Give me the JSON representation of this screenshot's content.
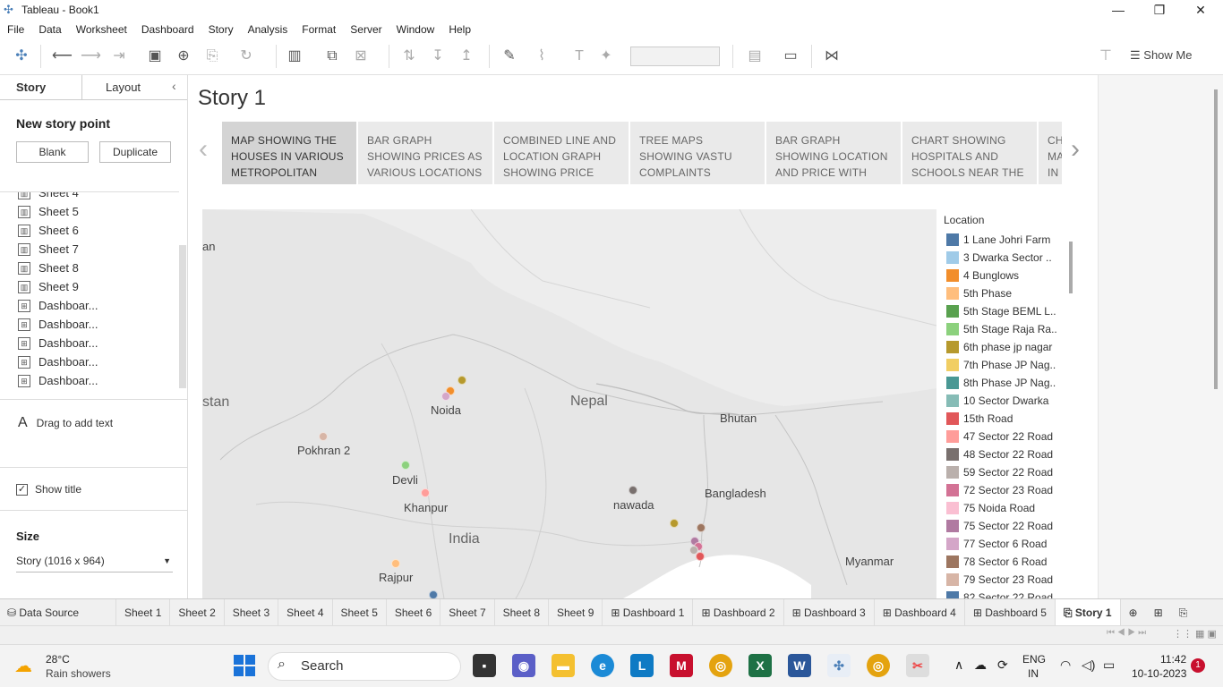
{
  "window": {
    "title": "Tableau - Book1",
    "minimize": "—",
    "restore": "❐",
    "close": "✕"
  },
  "menu": [
    "File",
    "Data",
    "Worksheet",
    "Dashboard",
    "Story",
    "Analysis",
    "Format",
    "Server",
    "Window",
    "Help"
  ],
  "toolbar": {
    "show_me": "Show Me"
  },
  "left_panel": {
    "tabs": {
      "story": "Story",
      "layout": "Layout"
    },
    "new_story_point": "New story point",
    "blank": "Blank",
    "duplicate": "Duplicate",
    "sheets": [
      "Sheet 4",
      "Sheet 5",
      "Sheet 6",
      "Sheet 7",
      "Sheet 8",
      "Sheet 9",
      "Dashboar...",
      "Dashboar...",
      "Dashboar...",
      "Dashboar...",
      "Dashboar..."
    ],
    "drag_text_icon": "A",
    "drag_text": "Drag to add text",
    "show_title": "Show title",
    "size_heading": "Size",
    "size_value": "Story (1016 x 964)"
  },
  "story": {
    "title": "Story 1",
    "points": [
      "MAP SHOWING THE HOUSES IN VARIOUS METROPOLITAN",
      "BAR GRAPH SHOWING PRICES AS VARIOUS LOCATIONS",
      "COMBINED LINE AND LOCATION GRAPH SHOWING PRICE AND",
      "TREE MAPS SHOWING VASTU COMPLAINTS",
      " BAR GRAPH SHOWING LOCATION AND PRICE WITH",
      "CHART SHOWING HOSPITALS AND SCHOOLS NEAR THE",
      "CH MA IN"
    ]
  },
  "map": {
    "labels": [
      "Nepal",
      "Bhutan",
      "Bangladesh",
      "India",
      "Myanmar",
      "Noida",
      "Pokhran 2",
      "Devli",
      "Khanpur",
      "nawada",
      "Rajpur",
      "stan",
      "an"
    ]
  },
  "legend": {
    "title": "Location",
    "items": [
      {
        "label": "1 Lane Johri Farm",
        "color": "#4e79a7"
      },
      {
        "label": "3 Dwarka Sector ..",
        "color": "#a0cbe8"
      },
      {
        "label": "4 Bunglows",
        "color": "#f28e2b"
      },
      {
        "label": "5th Phase",
        "color": "#ffbe7d"
      },
      {
        "label": "5th Stage BEML L..",
        "color": "#59a14f"
      },
      {
        "label": "5th Stage Raja Ra..",
        "color": "#8cd17d"
      },
      {
        "label": "6th phase jp nagar",
        "color": "#b6992d"
      },
      {
        "label": "7th Phase JP Nag..",
        "color": "#f1ce63"
      },
      {
        "label": "8th Phase JP Nag..",
        "color": "#499894"
      },
      {
        "label": "10 Sector Dwarka",
        "color": "#86bcb6"
      },
      {
        "label": "15th Road",
        "color": "#e15759"
      },
      {
        "label": "47 Sector 22 Road",
        "color": "#ff9d9a"
      },
      {
        "label": "48 Sector 22 Road",
        "color": "#79706e"
      },
      {
        "label": "59 Sector 22 Road",
        "color": "#bab0ac"
      },
      {
        "label": "72 Sector 23 Road",
        "color": "#d37295"
      },
      {
        "label": "75 Noida Road",
        "color": "#fabfd2"
      },
      {
        "label": "75 Sector 22 Road",
        "color": "#b07aa1"
      },
      {
        "label": "77 Sector 6 Road",
        "color": "#d4a6c8"
      },
      {
        "label": "78 Sector 6 Road",
        "color": "#9d7660"
      },
      {
        "label": "79 Sector 23 Road",
        "color": "#d7b5a6"
      },
      {
        "label": "82 Sector 22 Road",
        "color": "#4e79a7"
      }
    ]
  },
  "bottom_tabs": [
    "Data Source",
    "Sheet 1",
    "Sheet 2",
    "Sheet 3",
    "Sheet 4",
    "Sheet 5",
    "Sheet 6",
    "Sheet 7",
    "Sheet 8",
    "Sheet 9",
    "Dashboard 1",
    "Dashboard 2",
    "Dashboard 3",
    "Dashboard 4",
    "Dashboard 5",
    "Story 1"
  ],
  "taskbar": {
    "temp": "28°C",
    "weather": "Rain showers",
    "search": "Search",
    "lang": "ENG",
    "region": "IN",
    "time": "11:42",
    "date": "10-10-2023",
    "notif": "1"
  }
}
